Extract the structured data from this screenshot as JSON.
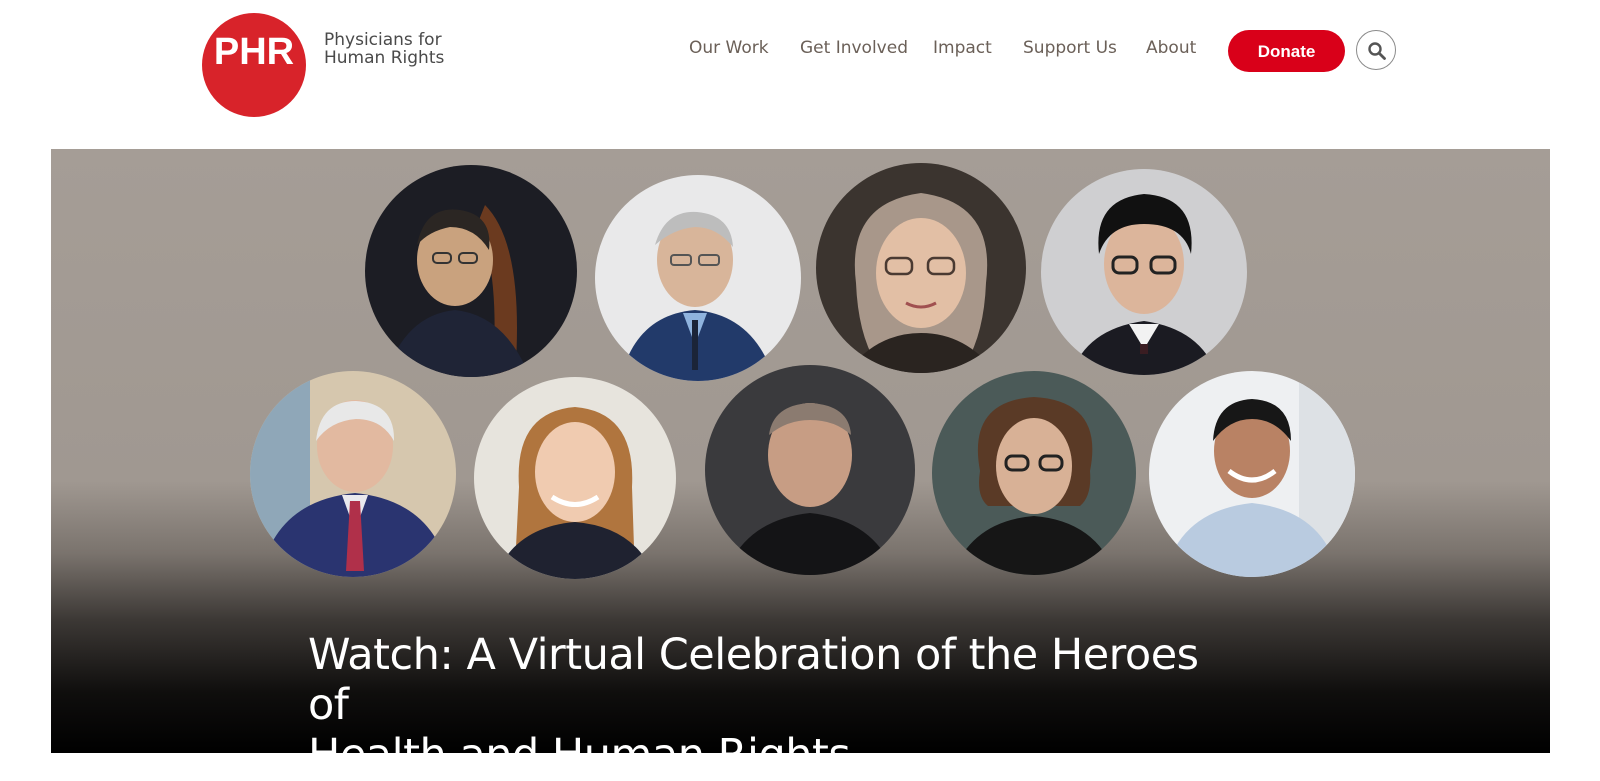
{
  "brand": {
    "abbr": "PHR",
    "name_line1": "Physicians for",
    "name_line2": "Human Rights",
    "color": "#d8232a"
  },
  "nav": {
    "items": [
      {
        "label": "Our Work"
      },
      {
        "label": "Get Involved"
      },
      {
        "label": "Impact"
      },
      {
        "label": "Support Us"
      },
      {
        "label": "About"
      }
    ],
    "donate_label": "Donate",
    "donate_color": "#d90019",
    "search_icon": "search-icon"
  },
  "hero": {
    "title_line1": "Watch: A Virtual Celebration of the Heroes of",
    "title_line2": "Health and Human Rights",
    "portrait_count": 9
  }
}
